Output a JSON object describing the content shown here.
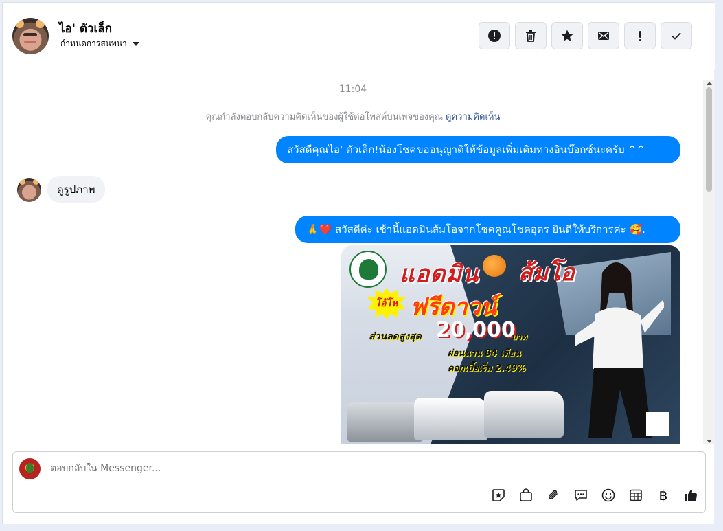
{
  "header": {
    "contact_name": "ไอ' ตัวเล็ก",
    "subtitle": "กำหนดการสนทนา",
    "actions": [
      {
        "icon": "alert-circle-icon",
        "label": "Report"
      },
      {
        "icon": "trash-icon",
        "label": "Delete"
      },
      {
        "icon": "star-icon",
        "label": "Star"
      },
      {
        "icon": "envelope-icon",
        "label": "Mark unread"
      },
      {
        "icon": "exclamation-icon",
        "label": "Spam"
      },
      {
        "icon": "check-icon",
        "label": "Done"
      }
    ]
  },
  "conversation": {
    "timestamp": "11:04",
    "notice_text": "คุณกำลังตอบกลับความคิดเห็นของผู้ใช้ต่อโพสต์บนเพจของคุณ",
    "notice_link": "ดูความคิดเห็น",
    "messages": [
      {
        "direction": "out",
        "text": "สวัสดีคุณไอ' ตัวเล็ก!น้องโชคขออนุญาติให้ข้อมูลเพิ่มเติมทางอินบ๊อกซ์นะครับ ^^"
      },
      {
        "direction": "in",
        "text": "ดูรูปภาพ"
      },
      {
        "direction": "out",
        "text": "🙏❤️ สวัสดีค่ะ เช้านี้แอดมินส้มโอจากโชคคูณโชคอุดร ยินดีให้บริการค่ะ 🥰."
      }
    ],
    "ad_image": {
      "title_left": "แอดมิน",
      "title_right": "ส้มโอ",
      "burst_label": "โอ้โห",
      "headline": "ฟรีดาวน์",
      "discount_label": "ส่วนลดสูงสุด",
      "discount_value": "20,000",
      "currency": "บาท",
      "line_term": "ผ่อนนาน 84 เดือน",
      "line_rate": "ดอกเบี้ยเริ่ม 2.49%"
    }
  },
  "composer": {
    "placeholder": "ตอบกลับใน Messenger...",
    "tools": [
      "sticker-icon",
      "shop-bag-icon",
      "paperclip-icon",
      "chat-bubble-icon",
      "emoji-icon",
      "table-icon",
      "baht-icon",
      "like-thumb-icon"
    ],
    "baht_symbol": "฿"
  }
}
